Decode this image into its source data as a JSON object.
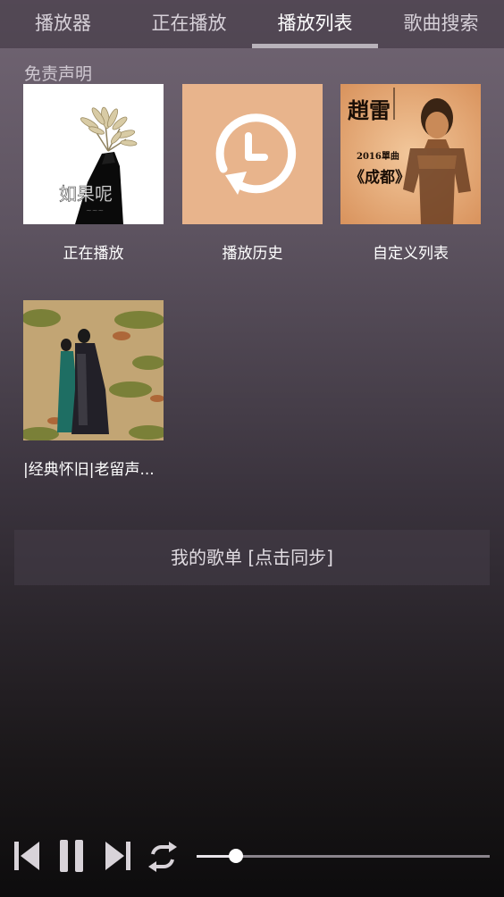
{
  "tabs": [
    {
      "label": "播放器"
    },
    {
      "label": "正在播放"
    },
    {
      "label": "播放列表"
    },
    {
      "label": "歌曲搜索"
    }
  ],
  "active_tab": "播放列表",
  "disclaimer": "免责声明",
  "playlists": [
    {
      "label": "正在播放",
      "cover_text": "如果呢"
    },
    {
      "label": "播放历史",
      "icon": "history-clock-icon"
    },
    {
      "label": "自定义列表",
      "cover_text": [
        "趙雷",
        "2016單曲",
        "《成都》"
      ]
    },
    {
      "label": "|经典怀旧|老留声..."
    }
  ],
  "sync_button": "我的歌单 [点击同步]",
  "player": {
    "progress": 0.135,
    "controls": [
      "previous-icon",
      "pause-icon",
      "next-icon",
      "repeat-icon"
    ]
  },
  "colors": {
    "history_bg": "#e8b48c",
    "accent_white": "#ffffff"
  }
}
